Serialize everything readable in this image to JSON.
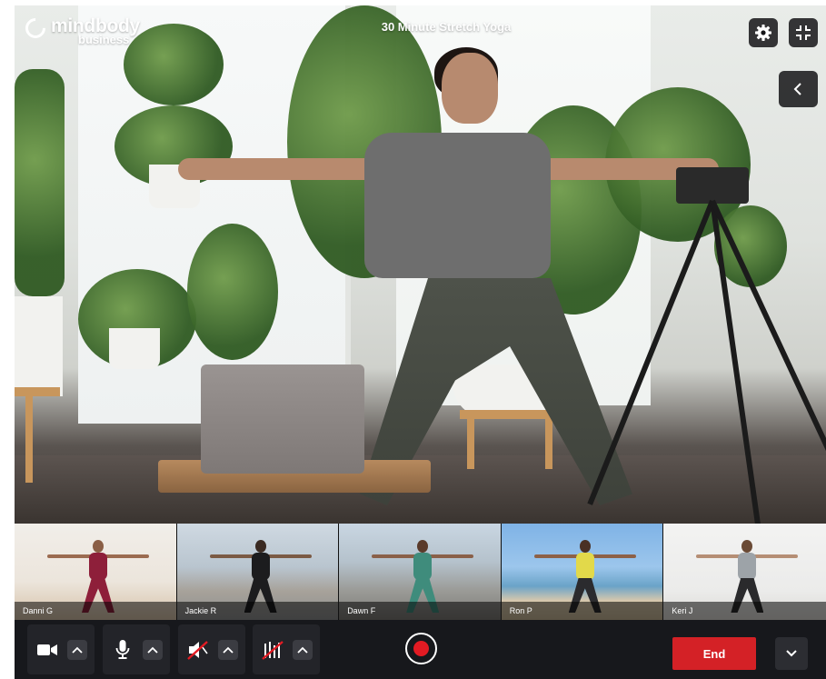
{
  "brand": {
    "name": "mindbody",
    "sub": "business"
  },
  "class_title": "30 Minute Stretch Yoga",
  "icons": {
    "settings": "gear-icon",
    "shrink": "exit-fullscreen-icon",
    "collapse": "chevron-left-icon",
    "camera": "video-camera-icon",
    "mic": "microphone-icon",
    "speaker": "speaker-muted-icon",
    "music": "music-muted-icon",
    "caret": "chevron-up-icon",
    "more": "chevron-down-icon",
    "record": "record-icon"
  },
  "participants": [
    {
      "name": "Danni G"
    },
    {
      "name": "Jackie R"
    },
    {
      "name": "Dawn F"
    },
    {
      "name": "Ron P"
    },
    {
      "name": "Keri J"
    }
  ],
  "controls": {
    "end_label": "End"
  },
  "colors": {
    "end": "#d42126",
    "record": "#e31b23",
    "bar": "#17181c"
  }
}
